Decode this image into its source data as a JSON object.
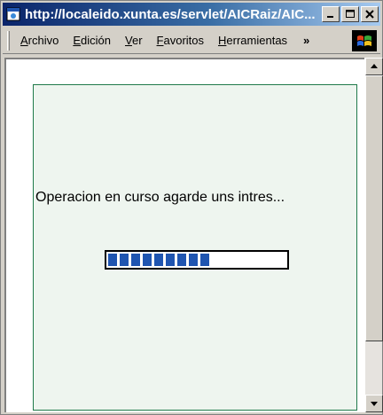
{
  "window": {
    "title": "http://localeido.xunta.es/servlet/AICRaiz/AIC...",
    "icons": {
      "app": "ie-page-icon",
      "minimize": "minimize-icon",
      "maximize": "maximize-icon",
      "close": "close-icon"
    }
  },
  "menubar": {
    "items": [
      {
        "mnemonic": "A",
        "rest": "rchivo"
      },
      {
        "mnemonic": "E",
        "rest": "dición"
      },
      {
        "mnemonic": "V",
        "rest": "er"
      },
      {
        "mnemonic": "F",
        "rest": "avoritos"
      },
      {
        "mnemonic": "H",
        "rest": "erramientas"
      }
    ],
    "overflow": "»",
    "logo": "windows-logo-icon"
  },
  "content": {
    "message": "Operacion en curso agarde uns intres...",
    "progress": {
      "blocks_filled": 9,
      "fraction": 0.6
    },
    "colors": {
      "panel_bg": "#eef5ef",
      "panel_border": "#1f7a4a",
      "progress_fill": "#1f55b0"
    }
  }
}
